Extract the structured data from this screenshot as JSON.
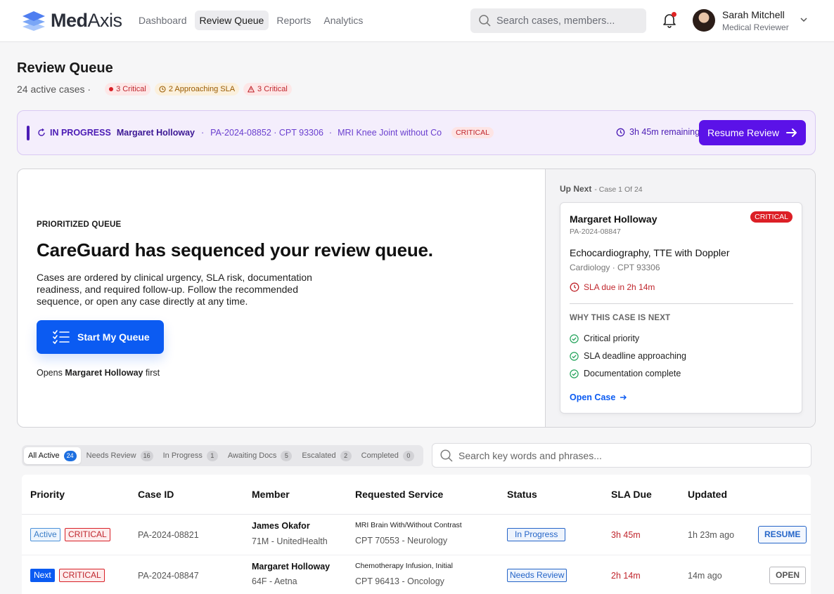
{
  "app": {
    "name_bold": "Med",
    "name_light": "Axis"
  },
  "nav": [
    {
      "label": "Dashboard"
    },
    {
      "label": "Review Queue",
      "active": true
    },
    {
      "label": "Reports"
    },
    {
      "label": "Analytics"
    }
  ],
  "search": {
    "placeholder": "Search cases, members..."
  },
  "user": {
    "name": "Sarah Mitchell",
    "role": "Medical Reviewer"
  },
  "page": {
    "title": "Review Queue",
    "active_cases": "24 active cases ·",
    "pills": [
      {
        "label": "3 Critical",
        "icon": "dot"
      },
      {
        "label": "2 Approaching SLA",
        "icon": "clock-icon"
      },
      {
        "label": "3 Critical",
        "icon": "alert-triangle-icon"
      }
    ]
  },
  "banner": {
    "status": "IN PROGRESS",
    "member": "Margaret Holloway",
    "sep": "·",
    "case": "PA-2024-08852 · CPT 93306",
    "service": "MRI Knee Joint without Co",
    "severity": "CRITICAL",
    "time_remaining": "3h 45m remaining",
    "resume_label": "Resume Review"
  },
  "hero": {
    "kicker": "PRIORITIZED QUEUE",
    "title": "CareGuard has sequenced your review queue.",
    "description": "Cases are ordered by clinical urgency, SLA risk, documentation readiness, and required follow-up. Follow the recommended sequence, or open any case directly at any time.",
    "start_label": "Start My Queue",
    "opens_prefix": "Opens",
    "opens_member": "Margaret Holloway",
    "opens_suffix": "first"
  },
  "up_next": {
    "label": "Up Next",
    "position": "- Case 1 Of 24",
    "member": "Margaret Holloway",
    "case_id": "PA-2024-08847",
    "severity": "CRITICAL",
    "service": "Echocardiography, TTE with Doppler",
    "specialty": "Cardiology · CPT 93306",
    "sla": "SLA due in 2h 14m",
    "why_label": "WHY THIS CASE IS NEXT",
    "reasons": [
      "Critical priority",
      "SLA deadline approaching",
      "Documentation complete"
    ],
    "open_label": "Open Case"
  },
  "filters": [
    {
      "label": "All Active",
      "count": "24",
      "active": true
    },
    {
      "label": "Needs Review",
      "count": "16"
    },
    {
      "label": "In Progress",
      "count": "1"
    },
    {
      "label": "Awaiting Docs",
      "count": "5"
    },
    {
      "label": "Escalated",
      "count": "2"
    },
    {
      "label": "Completed",
      "count": "0"
    }
  ],
  "table_search": {
    "placeholder": "Search key words and phrases..."
  },
  "table": {
    "columns": [
      "Priority",
      "Case ID",
      "Member",
      "Requested Service",
      "Status",
      "SLA Due",
      "Updated"
    ],
    "rows": [
      {
        "tag": "Active",
        "priority": "CRITICAL",
        "case_id": "PA-2024-08821",
        "member": "James Okafor",
        "member_sub": "71M - UnitedHealth",
        "service": "MRI Brain With/Without Contrast",
        "service_sub": "CPT 70553 - Neurology",
        "status": "In Progress",
        "sla": "3h 45m",
        "updated": "1h 23m ago",
        "action": "RESUME"
      },
      {
        "tag": "Next",
        "priority": "CRITICAL",
        "case_id": "PA-2024-08847",
        "member": "Margaret Holloway",
        "member_sub": "64F - Aetna",
        "service": "Chemotherapy Infusion, Initial",
        "service_sub": "CPT 96413 - Oncology",
        "status": "Needs Review",
        "sla": "2h 14m",
        "updated": "14m ago",
        "action": "OPEN"
      }
    ]
  }
}
